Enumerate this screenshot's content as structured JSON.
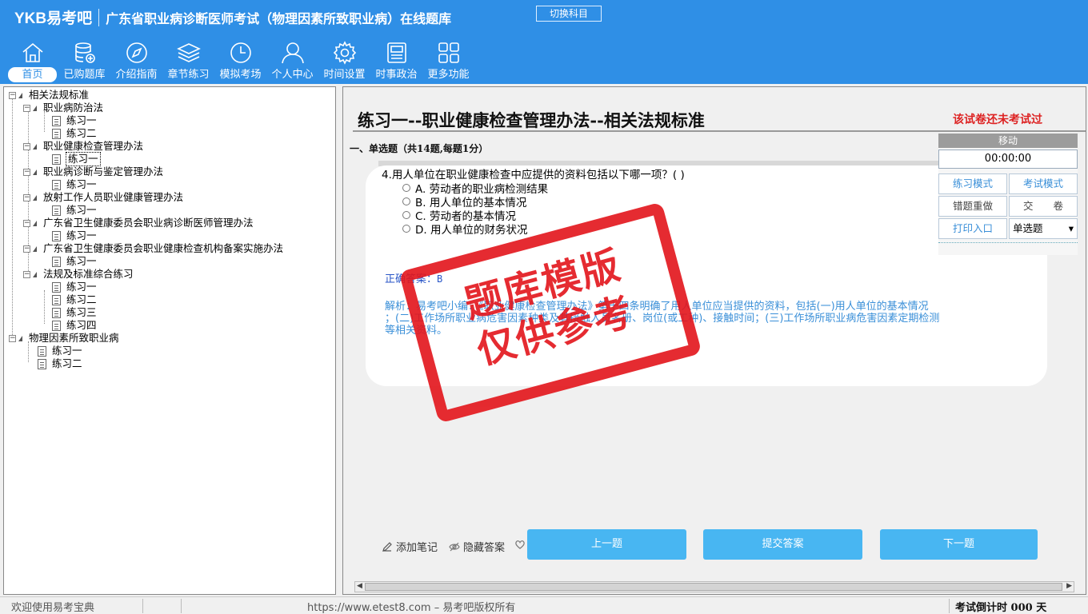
{
  "header": {
    "logo": "YKB易考吧",
    "title": "广东省职业病诊断医师考试（物理因素所致职业病）在线题库",
    "switch_subject": "切换科目"
  },
  "nav": [
    {
      "label": "首页",
      "icon": "home-icon"
    },
    {
      "label": "已购题库",
      "icon": "database-icon"
    },
    {
      "label": "介绍指南",
      "icon": "compass-icon"
    },
    {
      "label": "章节练习",
      "icon": "layers-icon"
    },
    {
      "label": "模拟考场",
      "icon": "clock-icon"
    },
    {
      "label": "个人中心",
      "icon": "user-icon"
    },
    {
      "label": "时间设置",
      "icon": "gear-icon"
    },
    {
      "label": "时事政治",
      "icon": "news-icon"
    },
    {
      "label": "更多功能",
      "icon": "grid-icon"
    }
  ],
  "tree": {
    "root1": "相关法规标准",
    "g1": "职业病防治法",
    "g1_items": [
      "练习一",
      "练习二"
    ],
    "g2": "职业健康检查管理办法",
    "g2_items": [
      "练习一"
    ],
    "g3": "职业病诊断与鉴定管理办法",
    "g3_items": [
      "练习一"
    ],
    "g4": "放射工作人员职业健康管理办法",
    "g4_items": [
      "练习一"
    ],
    "g5": "广东省卫生健康委员会职业病诊断医师管理办法",
    "g5_items": [
      "练习一"
    ],
    "g6": "广东省卫生健康委员会职业健康检查机构备案实施办法",
    "g6_items": [
      "练习一"
    ],
    "g7": "法规及标准综合练习",
    "g7_items": [
      "练习一",
      "练习二",
      "练习三",
      "练习四"
    ],
    "root2": "物理因素所致职业病",
    "r2_items": [
      "练习一",
      "练习二"
    ]
  },
  "main": {
    "paper_title": "练习一--职业健康检查管理办法--相关法规标准",
    "status_note": "该试卷还未考试过",
    "section": "一、单选题（共14题,每题1分）",
    "question": "4.用人单位在职业健康检查中应提供的资料包括以下哪一项？( )",
    "options": [
      "A. 劳动者的职业病检测结果",
      "B. 用人单位的基本情况",
      "C. 劳动者的基本情况",
      "D. 用人单位的财务状况"
    ],
    "answer_label": "正确答案：",
    "answer_value": "B",
    "analysis_l1": "解析：易考吧小编：《职业健康检查管理办法》第十四条明确了用人单位应当提供的资料，包括(一)用人单位的基本情况",
    "analysis_l2": "；(二)工作场所职业病危害因素种类及其接触人员名册、岗位(或工种)、接触时间；(三)工作场所职业病危害因素定期检测",
    "analysis_l3": "等相关资料。"
  },
  "control": {
    "move": "移动",
    "timer": "00:00:00",
    "practice_mode": "练习模式",
    "exam_mode": "考试模式",
    "redo_wrong": "错题重做",
    "submit_paper": "交　　卷",
    "print": "打印入口",
    "type_select": "单选题"
  },
  "actions": {
    "add_note": "添加笔记",
    "hide_answer": "隐藏答案",
    "prev": "上一题",
    "submit": "提交答案",
    "next": "下一题"
  },
  "watermark": {
    "line1": "题库模版",
    "line2": "仅供参考"
  },
  "status": {
    "welcome": "欢迎使用易考宝典",
    "copyright": "https://www.etest8.com – 易考吧版权所有",
    "countdown": "考试倒计时 000 天"
  },
  "colors": {
    "header": "#2f8fe6",
    "button": "#48b6f2",
    "stamp": "#e3151b",
    "warning": "#dd2222"
  }
}
